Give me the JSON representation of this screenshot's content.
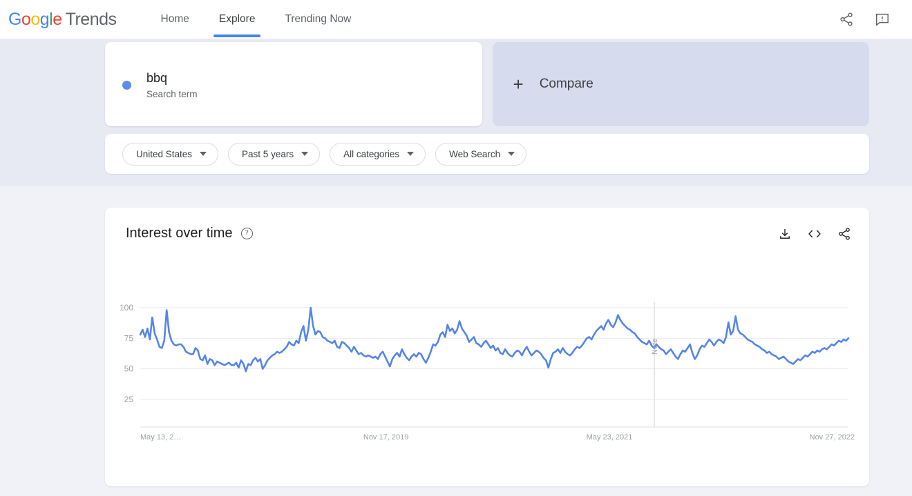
{
  "header": {
    "logo": {
      "word1": "Google",
      "word2": "Trends"
    },
    "nav": [
      {
        "label": "Home",
        "active": false
      },
      {
        "label": "Explore",
        "active": true
      },
      {
        "label": "Trending Now",
        "active": false
      }
    ],
    "actions": [
      {
        "name": "share-icon",
        "label": "Share"
      },
      {
        "name": "feedback-icon",
        "label": "Send feedback"
      }
    ]
  },
  "search": {
    "term": "bbq",
    "type": "Search term",
    "dot_color": "#5E8BF0",
    "compare_label": "Compare",
    "compare_plus": "+"
  },
  "filters": [
    {
      "name": "location",
      "label": "United States"
    },
    {
      "name": "time-range",
      "label": "Past 5 years"
    },
    {
      "name": "category",
      "label": "All categories"
    },
    {
      "name": "search-type",
      "label": "Web Search"
    }
  ],
  "chart_card": {
    "title": "Interest over time",
    "help_glyph": "?",
    "tools": [
      {
        "name": "download-button",
        "label": "Download CSV"
      },
      {
        "name": "embed-button",
        "label": "Embed"
      },
      {
        "name": "share-button",
        "label": "Share"
      }
    ]
  },
  "chart_data": {
    "type": "line",
    "title": "Interest over time",
    "xlabel": "",
    "ylabel": "",
    "ylim": [
      0,
      105
    ],
    "yticks": [
      100,
      75,
      50,
      25
    ],
    "grid": true,
    "legend": false,
    "line_color": "#5585E8",
    "xticks": [
      "May 13, 2…",
      "Nov 17, 2019",
      "May 23, 2021",
      "Nov 27, 2022"
    ],
    "xtick_positions": [
      0,
      0.315,
      0.63,
      0.945
    ],
    "annotations": [
      {
        "label": "Note",
        "x_fraction": 0.726,
        "type": "vertical-line"
      }
    ],
    "series": [
      {
        "name": "bbq",
        "values": [
          78,
          82,
          76,
          83,
          74,
          92,
          79,
          74,
          68,
          67,
          73,
          98,
          80,
          73,
          70,
          69,
          70,
          70,
          68,
          64,
          63,
          62,
          62,
          67,
          65,
          58,
          57,
          61,
          54,
          58,
          57,
          53,
          56,
          55,
          54,
          53,
          54,
          55,
          53,
          53,
          55,
          51,
          57,
          54,
          48,
          54,
          53,
          57,
          59,
          56,
          58,
          50,
          53,
          57,
          59,
          61,
          62,
          64,
          63,
          64,
          66,
          68,
          72,
          70,
          69,
          73,
          71,
          80,
          85,
          73,
          82,
          100,
          85,
          78,
          81,
          80,
          76,
          75,
          73,
          72,
          71,
          73,
          68,
          67,
          72,
          71,
          69,
          67,
          64,
          68,
          65,
          62,
          63,
          61,
          60,
          61,
          60,
          59,
          60,
          58,
          62,
          64,
          60,
          56,
          52,
          58,
          61,
          63,
          60,
          66,
          62,
          59,
          57,
          60,
          62,
          60,
          63,
          62,
          58,
          55,
          59,
          64,
          70,
          69,
          72,
          78,
          80,
          76,
          86,
          81,
          83,
          79,
          82,
          89,
          83,
          80,
          77,
          72,
          74,
          76,
          71,
          70,
          68,
          71,
          73,
          70,
          67,
          69,
          65,
          67,
          63,
          62,
          66,
          63,
          61,
          60,
          63,
          65,
          64,
          61,
          65,
          68,
          64,
          61,
          63,
          65,
          64,
          62,
          59,
          57,
          51,
          58,
          63,
          64,
          66,
          63,
          67,
          64,
          62,
          61,
          63,
          66,
          68,
          67,
          69,
          72,
          75,
          76,
          74,
          78,
          81,
          83,
          85,
          82,
          87,
          90,
          86,
          84,
          88,
          94,
          90,
          87,
          85,
          83,
          82,
          80,
          79,
          76,
          74,
          72,
          71,
          70,
          73,
          69,
          67,
          70,
          68,
          66,
          65,
          62,
          64,
          66,
          63,
          60,
          58,
          62,
          65,
          64,
          67,
          70,
          63,
          58,
          61,
          66,
          69,
          68,
          71,
          74,
          72,
          69,
          72,
          74,
          73,
          71,
          76,
          88,
          78,
          81,
          93,
          82,
          79,
          78,
          76,
          74,
          73,
          72,
          70,
          69,
          68,
          66,
          65,
          63,
          64,
          62,
          61,
          60,
          58,
          59,
          60,
          58,
          56,
          55,
          54,
          56,
          58,
          57,
          59,
          61,
          60,
          62,
          64,
          63,
          65,
          64,
          66,
          67,
          66,
          68,
          70,
          69,
          71,
          73,
          72,
          74,
          73,
          75
        ]
      }
    ]
  }
}
